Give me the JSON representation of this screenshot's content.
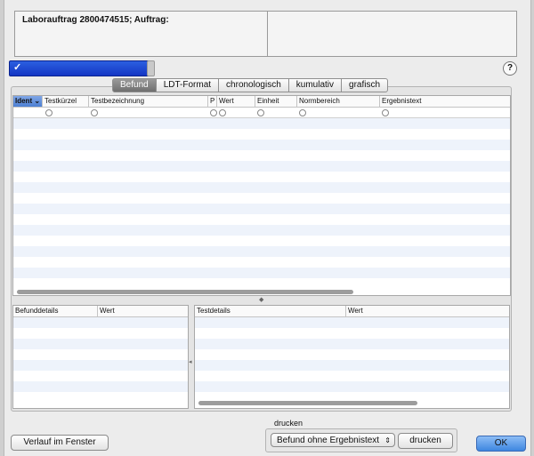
{
  "header": {
    "title": "Laborauftrag 2800474515; Auftrag:"
  },
  "selector": {
    "checkmark": "✓"
  },
  "help": {
    "label": "?"
  },
  "tabs": [
    {
      "label": "Befund",
      "active": true
    },
    {
      "label": "LDT-Format",
      "active": false
    },
    {
      "label": "chronologisch",
      "active": false
    },
    {
      "label": "kumulativ",
      "active": false
    },
    {
      "label": "grafisch",
      "active": false
    }
  ],
  "main_table": {
    "columns": [
      "Ident",
      "Testkürzel",
      "Testbezeichnung",
      "P",
      "Wert",
      "Einheit",
      "Normbereich",
      "Ergebnistext"
    ],
    "sorted_column": "Ident",
    "sort_indicator": "⌄"
  },
  "details_table": {
    "columns": [
      "Befunddetails",
      "Wert"
    ]
  },
  "test_details_table": {
    "columns": [
      "Testdetails",
      "Wert"
    ]
  },
  "footer": {
    "history_button": "Verlauf im Fenster",
    "print_label": "drucken",
    "print_option": "Befund ohne Ergebnistext",
    "print_button": "drucken",
    "ok_button": "OK"
  },
  "colors": {
    "selection": "#1d44d0",
    "ok_accent": "#3e86e0",
    "row_alt": "#eef3fb"
  }
}
